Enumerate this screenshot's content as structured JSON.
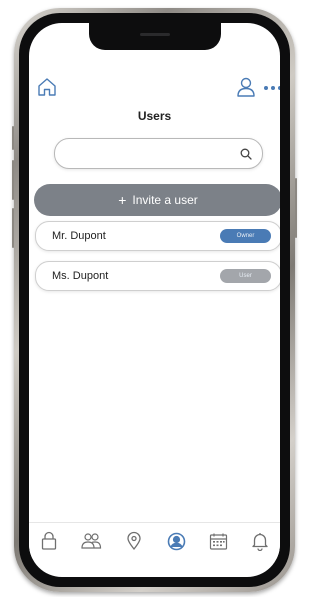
{
  "header": {
    "title": "Users",
    "home_icon": "home-icon",
    "user_icon": "user-profile-icon",
    "more_icon": "more-dots-icon"
  },
  "search": {
    "value": "",
    "placeholder": "",
    "icon": "search-icon"
  },
  "invite": {
    "label": "Invite a user",
    "icon": "plus-icon"
  },
  "users": [
    {
      "name": "Mr. Dupont",
      "role": "Owner",
      "badge_color": "#4a7bb5"
    },
    {
      "name": "Ms. Dupont",
      "role": "User",
      "badge_color": "#a3a6ab"
    }
  ],
  "bottom_nav": [
    {
      "icon": "lock-icon",
      "active": false
    },
    {
      "icon": "group-icon",
      "active": false
    },
    {
      "icon": "location-pin-icon",
      "active": false
    },
    {
      "icon": "user-circle-icon",
      "active": true
    },
    {
      "icon": "calendar-icon",
      "active": false
    },
    {
      "icon": "bell-icon",
      "active": false
    }
  ],
  "colors": {
    "accent": "#4a7bb5",
    "invite_button": "#7c8188",
    "icon_gray": "#6f6f6f"
  }
}
